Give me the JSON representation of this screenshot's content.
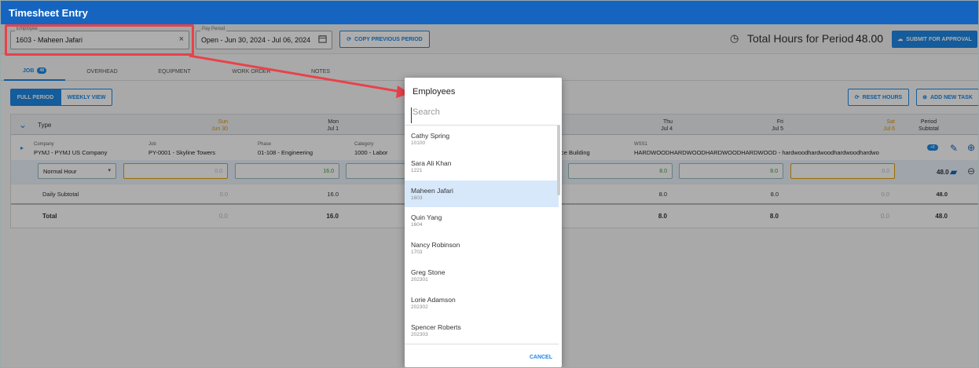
{
  "app": {
    "title": "Timesheet Entry"
  },
  "toolbar": {
    "employee_label": "Employee",
    "employee_value": "1603 - Maheen Jafari",
    "pay_period_label": "Pay Period",
    "pay_period_value": "Open - Jun 30, 2024 - Jul 06, 2024",
    "copy_label": "Copy Previous Period",
    "total_hours_label": "Total Hours for Period",
    "total_hours_value": "48.00",
    "submit_label": "Submit For Approval"
  },
  "tabs": [
    {
      "label": "Job",
      "badge": "48",
      "active": true
    },
    {
      "label": "Overhead"
    },
    {
      "label": "Equipment"
    },
    {
      "label": "Work Order"
    },
    {
      "label": "Notes"
    }
  ],
  "view": {
    "full_period": "Full Period",
    "weekly_view": "Weekly View",
    "reset_hours": "Reset Hours",
    "add_task": "Add New Task"
  },
  "grid": {
    "type_header": "Type",
    "days": [
      {
        "name": "Sun",
        "date": "Jun 30",
        "weekend": true
      },
      {
        "name": "Mon",
        "date": "Jul 1"
      },
      {
        "name": "Thu",
        "date": "Jul 4"
      },
      {
        "name": "Fri",
        "date": "Jul 5"
      },
      {
        "name": "Sat",
        "date": "Jul 6",
        "weekend": true
      }
    ],
    "period_header": "Period",
    "subtotal_header": "Subtotal",
    "task": {
      "company_label": "Company",
      "company": "PYMJ - PYMJ US Company",
      "job_label": "Job",
      "job": "PY-0001 - Skyline Towers",
      "phase_label": "Phase",
      "phase": "01-108 - Engineering",
      "category_label": "Category",
      "category": "1000 - Labor",
      "building": "ce Building",
      "wss_label": "WSS1",
      "wss": "HARDWOODHARDWOODHARDWOODHARDWOOD - hardwoodhardwoodhardwoodhardwo"
    },
    "hour_type": "Normal Hour",
    "hours": [
      "0.0",
      "16.0",
      "8.0",
      "8.0",
      "0.0"
    ],
    "row_total": "48.0",
    "daily_subtotal_label": "Daily Subtotal",
    "daily": [
      "0.0",
      "16.0",
      "8.0",
      "8.0",
      "0.0"
    ],
    "daily_total": "48.0",
    "total_label": "Total",
    "totals": [
      "0.0",
      "16.0",
      "8.0",
      "8.0",
      "0.0"
    ],
    "grand_total": "48.0"
  },
  "dialog": {
    "title": "Employees",
    "search_placeholder": "Search",
    "employees": [
      {
        "name": "Cathy Spring",
        "id": "10100"
      },
      {
        "name": "Sara Ali Khan",
        "id": "1221"
      },
      {
        "name": "Maheen Jafari",
        "id": "1603",
        "selected": true
      },
      {
        "name": "Quin Yang",
        "id": "1604"
      },
      {
        "name": "Nancy Robinson",
        "id": "1703"
      },
      {
        "name": "Greg Stone",
        "id": "202301"
      },
      {
        "name": "Lorie Adamson",
        "id": "202302"
      },
      {
        "name": "Spencer Roberts",
        "id": "202303"
      }
    ],
    "cancel_label": "Cancel"
  },
  "colors": {
    "primary": "#1565c0",
    "accent": "#1e88e5",
    "highlight": "#e8424a",
    "weekend": "#e59400"
  }
}
